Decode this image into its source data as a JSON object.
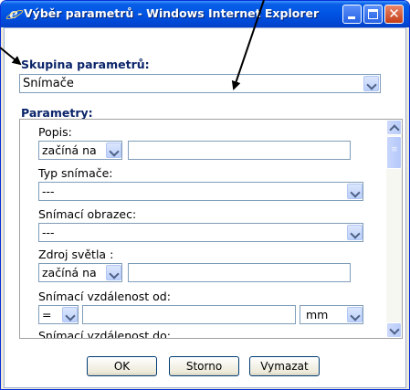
{
  "window": {
    "title": "Výběr parametrů - Windows Internet Explorer"
  },
  "skupina": {
    "label": "Skupina parametrů:",
    "selected": "Snímače"
  },
  "parametry": {
    "label": "Parametry:",
    "fields": [
      {
        "label": "Popis:",
        "operator": "začíná na",
        "value": ""
      },
      {
        "label": "Typ snímače:",
        "selected": "---"
      },
      {
        "label": "Snímací obrazec:",
        "selected": "---"
      },
      {
        "label": "Zdroj světla :",
        "operator": "začíná na",
        "value": ""
      },
      {
        "label": "Snímací vzdálenost od:",
        "operator": "=",
        "value": "",
        "unit": "mm"
      },
      {
        "label": "Snímací vzdálenost do:"
      }
    ]
  },
  "buttons": {
    "ok": "OK",
    "storno": "Storno",
    "vymazat": "Vymazat"
  },
  "colors": {
    "titlebar": "#0055e5",
    "group_label": "#0a246a",
    "arrow": "#000000"
  }
}
